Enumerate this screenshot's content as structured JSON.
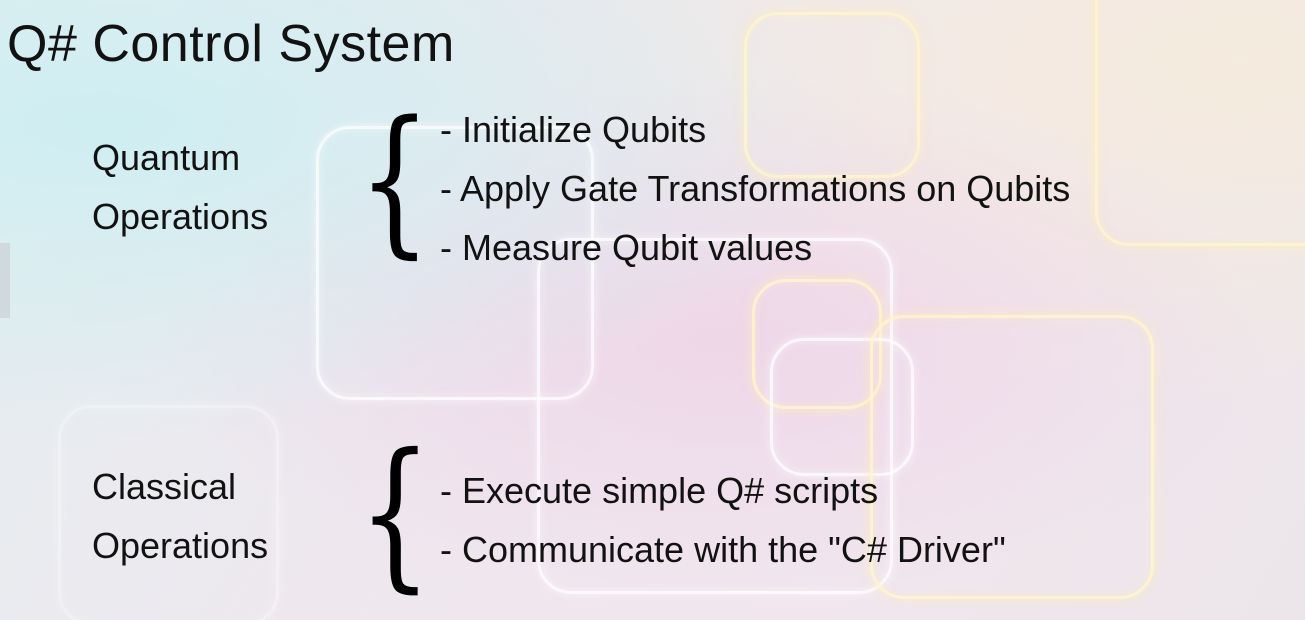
{
  "slide": {
    "title": "Q#  Control System",
    "sections": [
      {
        "label_lines": [
          "Quantum",
          "Operations"
        ],
        "brace": "{",
        "items": [
          "- Initialize Qubits",
          "- Apply Gate Transformations on Qubits",
          "- Measure Qubit values"
        ]
      },
      {
        "label_lines": [
          "Classical",
          "Operations"
        ],
        "brace": "{",
        "items": [
          "- Execute simple Q# scripts",
          "- Communicate with the \"C# Driver\""
        ]
      }
    ]
  }
}
